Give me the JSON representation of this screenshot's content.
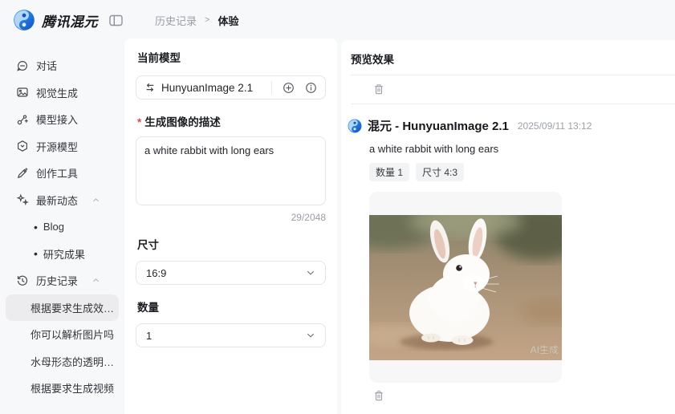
{
  "topbar": {
    "brand": "腾讯混元",
    "breadcrumb": {
      "parent": "历史记录",
      "separator": ">",
      "current": "体验"
    }
  },
  "sidebar": {
    "items": [
      {
        "label": "对话"
      },
      {
        "label": "视觉生成"
      },
      {
        "label": "模型接入"
      },
      {
        "label": "开源模型"
      },
      {
        "label": "创作工具"
      },
      {
        "label": "最新动态",
        "expanded": true
      },
      {
        "label": "历史记录",
        "expanded": true
      }
    ],
    "news_children": [
      "Blog",
      "研究成果"
    ],
    "history_children": [
      "根据要求生成效…",
      "你可以解析图片吗",
      "水母形态的透明…",
      "根据要求生成视频"
    ],
    "selected_history_index": 0
  },
  "form": {
    "model_section_label": "当前模型",
    "model_name": "HunyuanImage 2.1",
    "prompt_required_mark": "*",
    "prompt_label": "生成图像的描述",
    "prompt_value": "a white rabbit with long ears",
    "char_count": "29/2048",
    "size_label": "尺寸",
    "size_value": "16:9",
    "count_label": "数量",
    "count_value": "1"
  },
  "preview": {
    "title": "预览效果",
    "result": {
      "title": "混元 - HunyuanImage 2.1",
      "timestamp": "2025/09/11 13:12",
      "prompt": "a white rabbit with long ears",
      "tags": [
        "数量 1",
        "尺寸 4:3"
      ],
      "image_alt": "a white rabbit sitting on dirt ground",
      "watermark": "AI生成"
    }
  },
  "colors": {
    "brand_blue": "#2f7ef7",
    "brand_blue_dark": "#0e56c9",
    "background": "#f7f8fa",
    "panel": "#ffffff",
    "selected_item_bg": "#ececee",
    "tag_bg": "#f2f3f5",
    "required_red": "#e84749"
  }
}
